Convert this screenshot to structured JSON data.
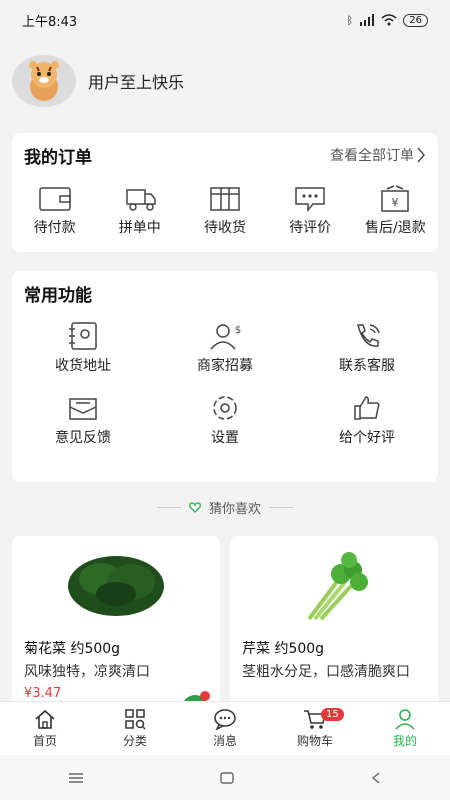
{
  "status": {
    "time": "上午8:43",
    "battery": "26"
  },
  "profile": {
    "username": "用户至上快乐"
  },
  "orders": {
    "title": "我的订单",
    "view_all": "查看全部订单",
    "items": [
      "待付款",
      "拼单中",
      "待收货",
      "待评价",
      "售后/退款"
    ]
  },
  "functions": {
    "title": "常用功能",
    "items": [
      "收货地址",
      "商家招募",
      "联系客服",
      "意见反馈",
      "设置",
      "给个好评"
    ]
  },
  "guess": {
    "label": "猜你喜欢"
  },
  "products": [
    {
      "name": "菊花菜 约500g",
      "desc": "风味独特，凉爽清口",
      "price": "¥3.47"
    },
    {
      "name": "芹菜 约500g",
      "desc": "茎粗水分足，口感清脆爽口",
      "price": ""
    }
  ],
  "tabbar": {
    "items": [
      "首页",
      "分类",
      "消息",
      "购物车",
      "我的"
    ],
    "cart_badge": "15"
  },
  "colors": {
    "accent": "#2bb24c",
    "price": "#e4393c"
  }
}
